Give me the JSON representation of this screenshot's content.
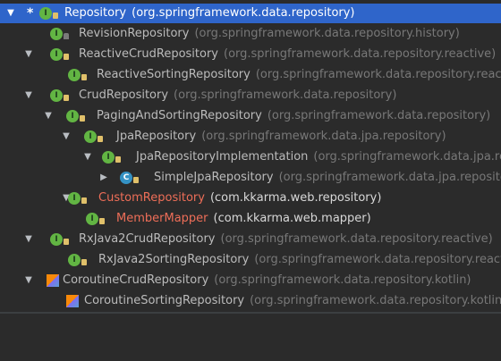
{
  "tree": {
    "rows": [
      {
        "expander": "▼",
        "star": "*",
        "icon": "interface",
        "name": "Repository",
        "pkg": "(org.springframework.data.repository)",
        "selected": true
      },
      {
        "expander": "",
        "icon": "interface",
        "name": "RevisionRepository",
        "pkg": "(org.springframework.data.repository.history)"
      },
      {
        "expander": "▼",
        "icon": "interface",
        "name": "ReactiveCrudRepository",
        "pkg": "(org.springframework.data.repository.reactive)"
      },
      {
        "expander": "",
        "icon": "interface",
        "name": "ReactiveSortingRepository",
        "pkg": "(org.springframework.data.repository.reactive)"
      },
      {
        "expander": "▼",
        "icon": "interface",
        "name": "CrudRepository",
        "pkg": "(org.springframework.data.repository)"
      },
      {
        "expander": "▼",
        "icon": "interface",
        "name": "PagingAndSortingRepository",
        "pkg": "(org.springframework.data.repository)"
      },
      {
        "expander": "▼",
        "icon": "interface",
        "name": "JpaRepository",
        "pkg": "(org.springframework.data.jpa.repository)"
      },
      {
        "expander": "▼",
        "icon": "interface",
        "name": "JpaRepositoryImplementation",
        "pkg": "(org.springframework.data.jpa.repository.support)"
      },
      {
        "expander": "▶",
        "icon": "class",
        "name": "SimpleJpaRepository",
        "pkg": "(org.springframework.data.jpa.repository.support)"
      },
      {
        "expander": "▼",
        "icon": "interface",
        "name": "CustomRepository",
        "pkg": "(com.kkarma.web.repository)",
        "red": true
      },
      {
        "expander": "",
        "icon": "interface",
        "name": "MemberMapper",
        "pkg": "(com.kkarma.web.mapper)",
        "red": true
      },
      {
        "expander": "▼",
        "icon": "interface",
        "name": "RxJava2CrudRepository",
        "pkg": "(org.springframework.data.repository.reactive)"
      },
      {
        "expander": "",
        "icon": "interface",
        "name": "RxJava2SortingRepository",
        "pkg": "(org.springframework.data.repository.reactive)"
      },
      {
        "expander": "▼",
        "icon": "kotlin",
        "name": "CoroutineCrudRepository",
        "pkg": "(org.springframework.data.repository.kotlin)"
      },
      {
        "expander": "",
        "icon": "kotlin",
        "name": "CoroutineSortingRepository",
        "pkg": "(org.springframework.data.repository.kotlin)"
      }
    ]
  },
  "colors": {
    "background": "#2b2b2b",
    "selection": "#2f65ca",
    "interface_icon": "#62b543",
    "class_icon": "#3592c4",
    "custom_name": "#ee6e58",
    "package_text": "#787878"
  }
}
